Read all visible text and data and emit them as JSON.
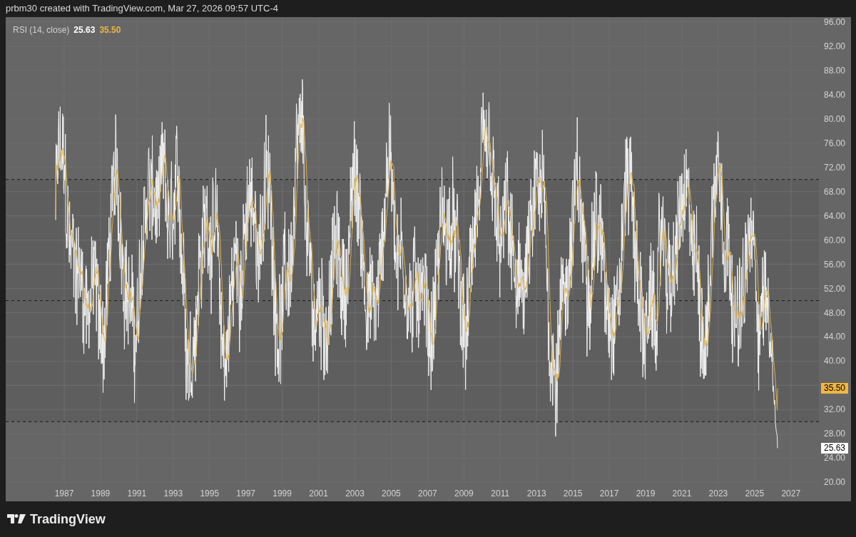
{
  "header": {
    "attribution": "prbm30 created with TradingView.com, Mar 27, 2026 09:57 UTC-4"
  },
  "legend": {
    "indicator": "RSI (14, close)",
    "rsi_value": "25.63",
    "ma_value": "35.50"
  },
  "y_axis": [
    "96.00",
    "92.00",
    "88.00",
    "84.00",
    "80.00",
    "76.00",
    "72.00",
    "68.00",
    "64.00",
    "60.00",
    "56.00",
    "52.00",
    "48.00",
    "44.00",
    "40.00",
    "32.00",
    "28.00",
    "24.00",
    "20.00"
  ],
  "x_axis": [
    "1987",
    "1989",
    "1991",
    "1993",
    "1995",
    "1997",
    "1999",
    "2001",
    "2003",
    "2005",
    "2007",
    "2009",
    "2011",
    "2013",
    "2015",
    "2017",
    "2019",
    "2021",
    "2023",
    "2025",
    "2027"
  ],
  "price_labels": [
    {
      "kind": "ma",
      "value": "35.50"
    },
    {
      "kind": "rsi",
      "value": "25.63"
    }
  ],
  "footer": {
    "brand": "TradingView"
  }
}
